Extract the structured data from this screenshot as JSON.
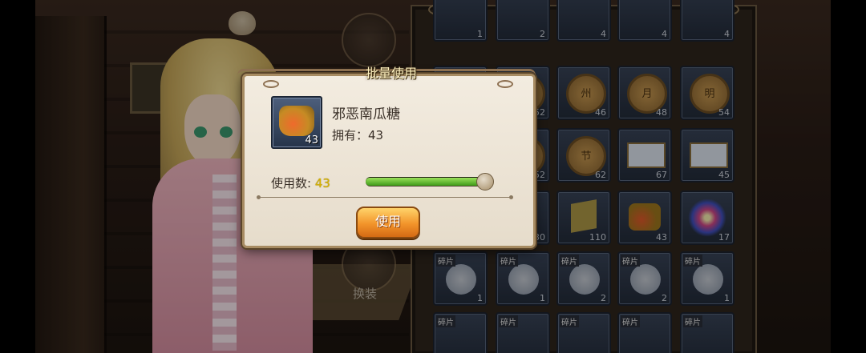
{
  "dialog": {
    "title": "批量使用",
    "item_name": "邪恶南瓜糖",
    "owned_label": "拥有：",
    "owned_value": "43",
    "item_count": "43",
    "use_label": "使用数:",
    "use_value": "43",
    "slider_fraction": 1.0,
    "use_button": "使用"
  },
  "side": {
    "equip_label": "换装"
  },
  "inventory": {
    "slots": [
      {
        "count": "1"
      },
      {
        "count": "2"
      },
      {
        "count": "4"
      },
      {
        "count": "4"
      },
      {
        "count": ""
      },
      {
        "count": "46",
        "char": "州"
      },
      {
        "count": "48",
        "char": "月"
      },
      {
        "count": "54",
        "char": "明"
      },
      {
        "count": "62",
        "char": "节"
      },
      {
        "count": "67"
      },
      {
        "count": "45"
      },
      {
        "count": "110"
      },
      {
        "count": "43"
      },
      {
        "count": "17"
      },
      {
        "frag": "碎片",
        "count": "1"
      },
      {
        "frag": "碎片",
        "count": "1"
      },
      {
        "frag": "碎片",
        "count": "2"
      },
      {
        "frag": "碎片",
        "count": "2"
      },
      {
        "frag": "碎片",
        "count": "1"
      },
      {
        "frag": "碎片"
      },
      {
        "frag": "碎片"
      },
      {
        "frag": "碎片"
      },
      {
        "frag": "碎片"
      },
      {
        "frag": "碎片"
      }
    ],
    "partial_counts": [
      "52",
      "52",
      "30"
    ]
  },
  "colors": {
    "accent_gold": "#d8b400",
    "button_orange": "#f2942a",
    "slider_green": "#3e9a18",
    "dialog_bg": "#f3ece0"
  }
}
